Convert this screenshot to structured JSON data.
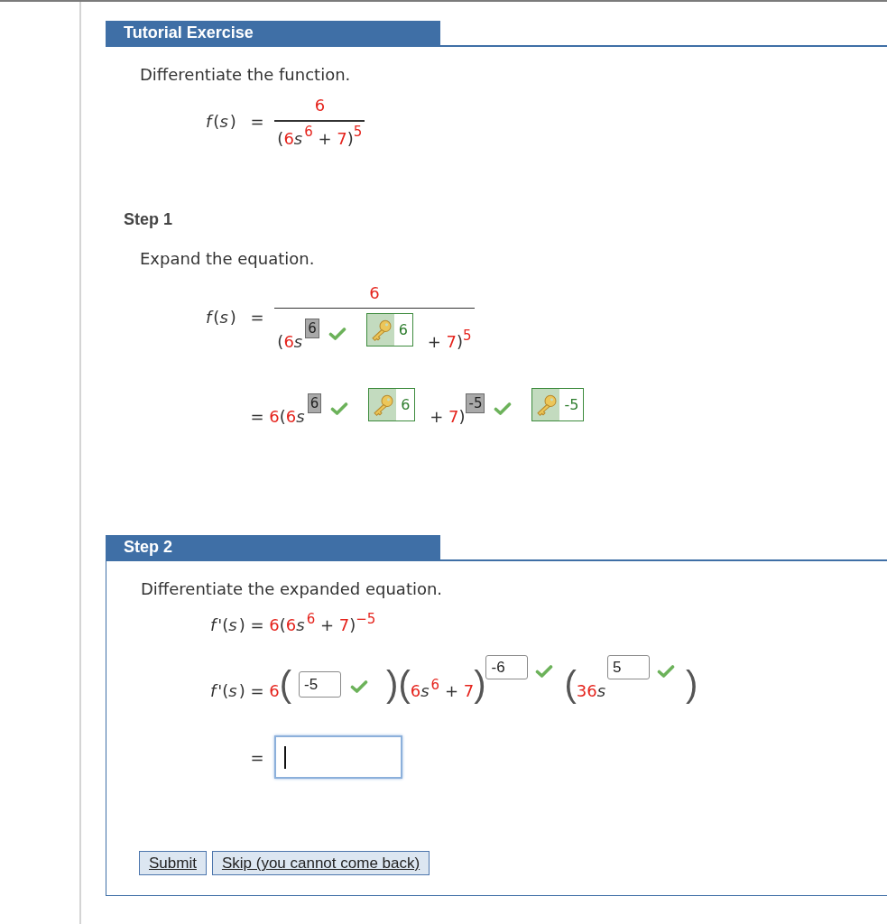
{
  "header": {
    "title": "Tutorial Exercise"
  },
  "problem": {
    "instruction": "Differentiate the function.",
    "lines": [
      {
        "lhs": [
          {
            "kind": "var",
            "text": "f"
          },
          {
            "kind": "plain",
            "text": "("
          },
          {
            "kind": "var",
            "text": "s"
          },
          {
            "kind": "plain",
            "text": ")"
          }
        ],
        "rhs": [
          {
            "kind": "op",
            "text": "="
          },
          {
            "kind": "fraction",
            "numerator": [
              {
                "kind": "value",
                "text": "6"
              }
            ],
            "denominator": [
              {
                "kind": "plain",
                "text": "("
              },
              {
                "kind": "value",
                "text": "6"
              },
              {
                "kind": "var",
                "text": "s"
              },
              {
                "kind": "value_sup",
                "text": "6"
              },
              {
                "kind": "op",
                "text": "+"
              },
              {
                "kind": "value",
                "text": "7"
              },
              {
                "kind": "plain",
                "text": ")"
              },
              {
                "kind": "value_sup",
                "text": "5"
              }
            ]
          }
        ]
      }
    ]
  },
  "step_1": {
    "title": "Step 1",
    "instruction": "Expand the equation.",
    "lines": [
      {
        "lhs": [
          {
            "kind": "var",
            "text": "f"
          },
          {
            "kind": "plain",
            "text": "("
          },
          {
            "kind": "var",
            "text": "s"
          },
          {
            "kind": "plain",
            "text": ")"
          }
        ],
        "rhs": [
          {
            "kind": "op",
            "text": "="
          },
          {
            "kind": "fraction",
            "numerator": [
              {
                "kind": "value",
                "text": "6"
              }
            ],
            "denominator": [
              {
                "kind": "plain",
                "text": "("
              },
              {
                "kind": "value",
                "text": "6"
              },
              {
                "kind": "var",
                "text": "s"
              },
              {
                "kind": "answer_sup",
                "value": "6",
                "correct": true
              },
              {
                "kind": "key",
                "value": "6"
              },
              {
                "kind": "op",
                "text": "+"
              },
              {
                "kind": "value",
                "text": "7"
              },
              {
                "kind": "plain",
                "text": ")"
              },
              {
                "kind": "value_sup",
                "text": "5"
              }
            ]
          }
        ]
      },
      {
        "rhs": [
          {
            "kind": "op",
            "text": "="
          },
          {
            "kind": "value",
            "text": "6"
          },
          {
            "kind": "plain",
            "text": "("
          },
          {
            "kind": "value",
            "text": "6"
          },
          {
            "kind": "var",
            "text": "s"
          },
          {
            "kind": "answer_sup",
            "value": "6",
            "correct": true
          },
          {
            "kind": "key",
            "value": "6"
          },
          {
            "kind": "op",
            "text": "+"
          },
          {
            "kind": "value",
            "text": "7"
          },
          {
            "kind": "plain",
            "text": ")"
          },
          {
            "kind": "answer_sup",
            "value": "-5",
            "correct": true
          },
          {
            "kind": "key",
            "value": "-5"
          }
        ]
      }
    ]
  },
  "step_2": {
    "title": "Step 2",
    "instruction": "Differentiate the expanded equation.",
    "lines": [
      {
        "lhs": [
          {
            "kind": "var",
            "text": "f"
          },
          {
            "kind": "plain",
            "text": "'("
          },
          {
            "kind": "var",
            "text": "s"
          },
          {
            "kind": "plain",
            "text": ")"
          }
        ],
        "rhs": [
          {
            "kind": "op",
            "text": "="
          },
          {
            "kind": "value",
            "text": "6"
          },
          {
            "kind": "plain",
            "text": "("
          },
          {
            "kind": "value",
            "text": "6"
          },
          {
            "kind": "var",
            "text": "s"
          },
          {
            "kind": "value_sup",
            "text": "6"
          },
          {
            "kind": "op",
            "text": "+"
          },
          {
            "kind": "value",
            "text": "7"
          },
          {
            "kind": "plain",
            "text": ")"
          },
          {
            "kind": "value_sup",
            "text": "−5"
          }
        ]
      },
      {
        "lhs": [
          {
            "kind": "var",
            "text": "f"
          },
          {
            "kind": "plain",
            "text": "'("
          },
          {
            "kind": "var",
            "text": "s"
          },
          {
            "kind": "plain",
            "text": ")"
          }
        ],
        "rhs": [
          {
            "kind": "op",
            "text": "="
          },
          {
            "kind": "value",
            "text": "6"
          },
          {
            "kind": "paren",
            "text": "("
          },
          {
            "kind": "input",
            "value": "-5",
            "correct": true
          },
          {
            "kind": "paren",
            "text": ")"
          },
          {
            "kind": "paren",
            "text": "("
          },
          {
            "kind": "value",
            "text": "6"
          },
          {
            "kind": "var",
            "text": "s"
          },
          {
            "kind": "value_sup",
            "text": "6"
          },
          {
            "kind": "op",
            "text": "+"
          },
          {
            "kind": "value",
            "text": "7"
          },
          {
            "kind": "paren",
            "text": ")"
          },
          {
            "kind": "input_sup",
            "value": "-6",
            "correct": true
          },
          {
            "kind": "paren",
            "text": "("
          },
          {
            "kind": "value",
            "text": "36"
          },
          {
            "kind": "var",
            "text": "s"
          },
          {
            "kind": "input_sup",
            "value": "5",
            "correct": true
          },
          {
            "kind": "paren",
            "text": ")"
          }
        ]
      },
      {
        "rhs": [
          {
            "kind": "op",
            "text": "="
          },
          {
            "kind": "field",
            "focused": true
          }
        ]
      }
    ],
    "buttons": [
      "Submit",
      "Skip (you cannot come back)"
    ]
  }
}
